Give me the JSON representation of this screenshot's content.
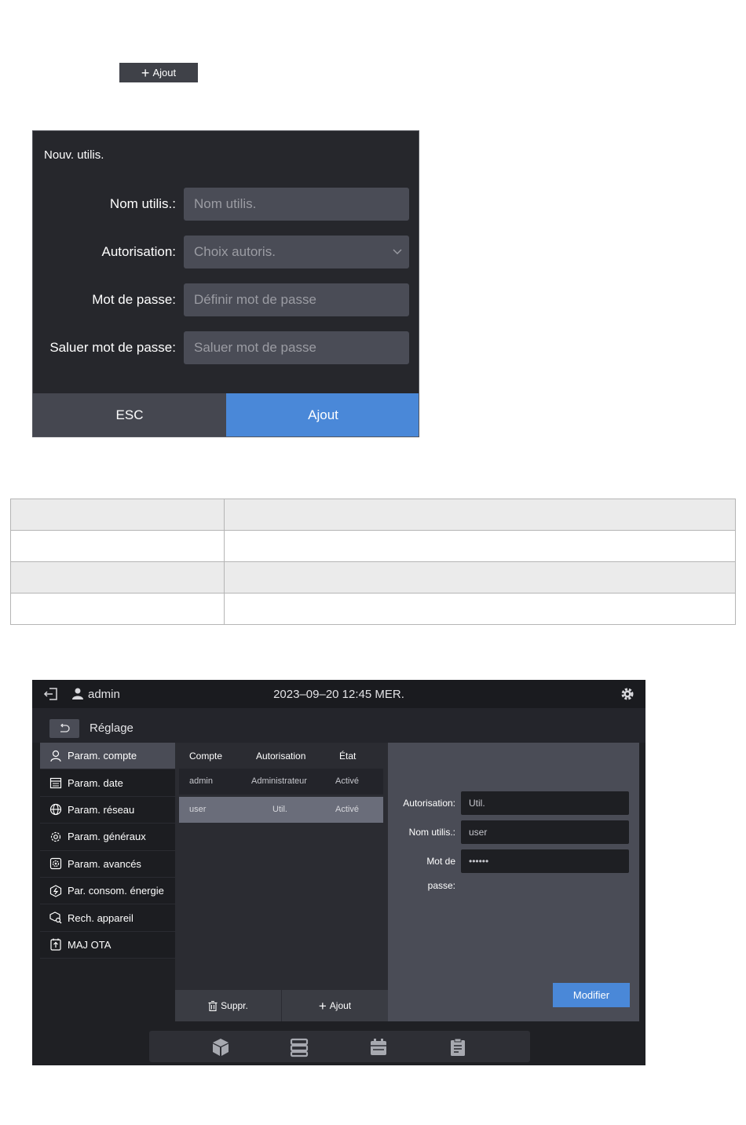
{
  "top_button": {
    "label": "Ajout"
  },
  "dialog": {
    "title": "Nouv. utilis.",
    "fields": [
      {
        "label": "Nom utilis.:",
        "placeholder": "Nom utilis."
      },
      {
        "label": "Autorisation:",
        "placeholder": "Choix autoris."
      },
      {
        "label": "Mot de passe:",
        "placeholder": "Définir mot de passe"
      },
      {
        "label": "Saluer mot de passe:",
        "placeholder": "Saluer mot de passe"
      }
    ],
    "esc_label": "ESC",
    "add_label": "Ajout"
  },
  "screen": {
    "user": "admin",
    "datetime": "2023–09–20 12:45 MER.",
    "page_title": "Réglage",
    "sidebar": [
      {
        "label": "Param. compte",
        "icon": "user-icon"
      },
      {
        "label": "Param. date",
        "icon": "calendar-icon"
      },
      {
        "label": "Param. réseau",
        "icon": "globe-icon"
      },
      {
        "label": "Param. généraux",
        "icon": "settings-icon"
      },
      {
        "label": "Param. avancés",
        "icon": "advanced-settings-icon"
      },
      {
        "label": "Par. consom. énergie",
        "icon": "energy-icon"
      },
      {
        "label": "Rech. appareil",
        "icon": "device-search-icon"
      },
      {
        "label": "MAJ OTA",
        "icon": "ota-update-icon"
      }
    ],
    "accounts": {
      "headers": [
        "Compte",
        "Autorisation",
        "État"
      ],
      "rows": [
        {
          "account": "admin",
          "role": "Administrateur",
          "state": "Activé"
        },
        {
          "account": "user",
          "role": "Util.",
          "state": "Activé"
        }
      ],
      "delete_label": "Suppr.",
      "add_label": "Ajout"
    },
    "detail": {
      "role_label": "Autorisation:",
      "role_value": "Util.",
      "name_label": "Nom utilis.:",
      "name_value": "user",
      "password_label_line1": "Mot de",
      "password_label_line2": "passe:",
      "password_value": "••••••",
      "modify_label": "Modifier"
    },
    "dock_icons": [
      "cube-icon",
      "server-icon",
      "schedule-icon",
      "clipboard-icon"
    ]
  }
}
